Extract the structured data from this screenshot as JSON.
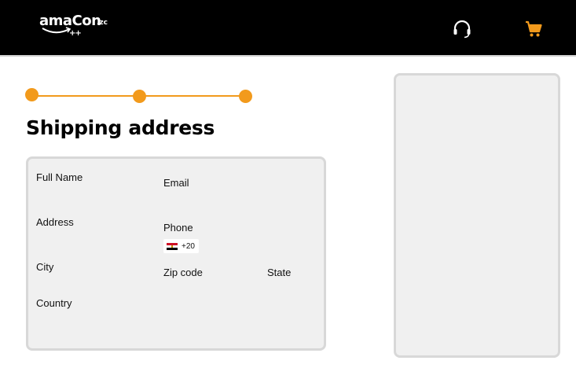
{
  "header": {
    "logo_text": "amaCon",
    "logo_suffix": ".zc",
    "logo_plus": "++",
    "icons": [
      "headset-icon",
      "cart-icon"
    ],
    "accent_color": "#f29a1c",
    "background_color": "#000000"
  },
  "stepper": {
    "steps": 3,
    "color": "#f29a1c"
  },
  "page": {
    "title": "Shipping address"
  },
  "form": {
    "full_name_label": "Full Name",
    "email_label": "Email",
    "address_label": "Address",
    "phone_label": "Phone",
    "phone_dial_code": "+20",
    "phone_country_flag": "egypt-flag-icon",
    "city_label": "City",
    "zip_label": "Zip code",
    "state_label": "State",
    "country_label": "Country"
  },
  "summary": {}
}
